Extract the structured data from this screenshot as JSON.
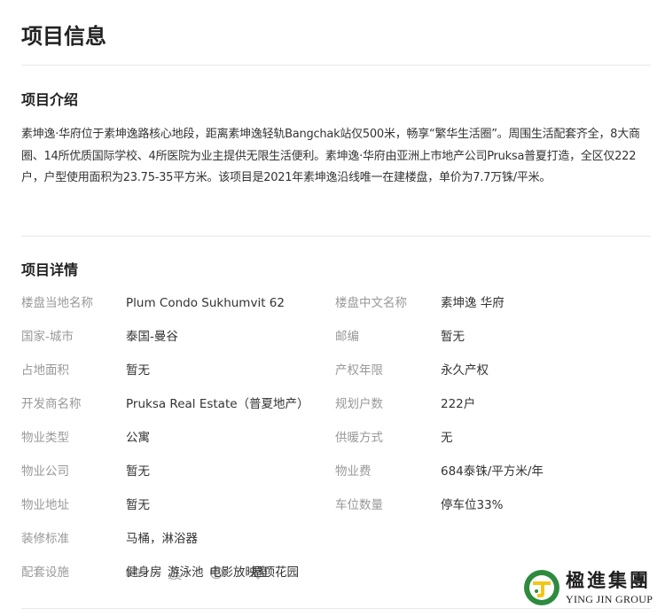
{
  "page": {
    "title": "项目信息"
  },
  "intro": {
    "title": "项目介绍",
    "text": "素坤逸·华府位于素坤逸路核心地段，距离素坤逸轻轨Bangchak站仅500米，畅享“繁华生活圈”。周围生活配套齐全，8大商圈、14所优质国际学校、4所医院为业主提供无限生活便利。素坤逸·华府由亚洲上市地产公司Pruksa普夏打造，全区仅222户，户型使用面积为23.75-35平方米。该项目是2021年素坤逸沿线唯一在建楼盘，单价为7.7万铢/平米。"
  },
  "details": {
    "title": "项目详情",
    "rows": [
      {
        "label1": "楼盘当地名称",
        "value1": "Plum Condo Sukhumvit 62",
        "label2": "楼盘中文名称",
        "value2": "素坤逸 华府"
      },
      {
        "label1": "国家-城市",
        "value1": "泰国-曼谷",
        "label2": "邮编",
        "value2": "暂无"
      },
      {
        "label1": "占地面积",
        "value1": "暂无",
        "label2": "产权年限",
        "value2": "永久产权"
      },
      {
        "label1": "开发商名称",
        "value1": "Pruksa Real Estate（普夏地产）",
        "label2": "规划户数",
        "value2": "222户"
      },
      {
        "label1": "物业类型",
        "value1": "公寓",
        "label2": "供暖方式",
        "value2": "无"
      },
      {
        "label1": "物业公司",
        "value1": "暂无",
        "label2": "物业费",
        "value2": "684泰铢/平方米/年"
      },
      {
        "label1": "物业地址",
        "value1": "暂无",
        "label2": "车位数量",
        "value2": "停车位33%"
      }
    ],
    "decoration": {
      "label": "装修标准",
      "value": "马桶，淋浴器"
    },
    "facilities": {
      "label": "配套设施",
      "items": [
        {
          "name": "健身房",
          "icon": "dumbbell-icon"
        },
        {
          "name": "游泳池",
          "icon": "pool-icon"
        },
        {
          "name": "电影放映室",
          "icon": "film-reel-icon"
        },
        {
          "name": "屋顶花园",
          "icon": "location-pin-icon"
        }
      ]
    }
  },
  "logo": {
    "cn": "楹進集團",
    "en": "YING JIN GROUP",
    "colors": {
      "green": "#2e8b3e",
      "yellow": "#f2c617"
    }
  },
  "colors": {
    "label": "#999999",
    "text": "#333333",
    "title": "#222222",
    "divider": "#e8e8e8",
    "icon": "#b0b0b0"
  }
}
